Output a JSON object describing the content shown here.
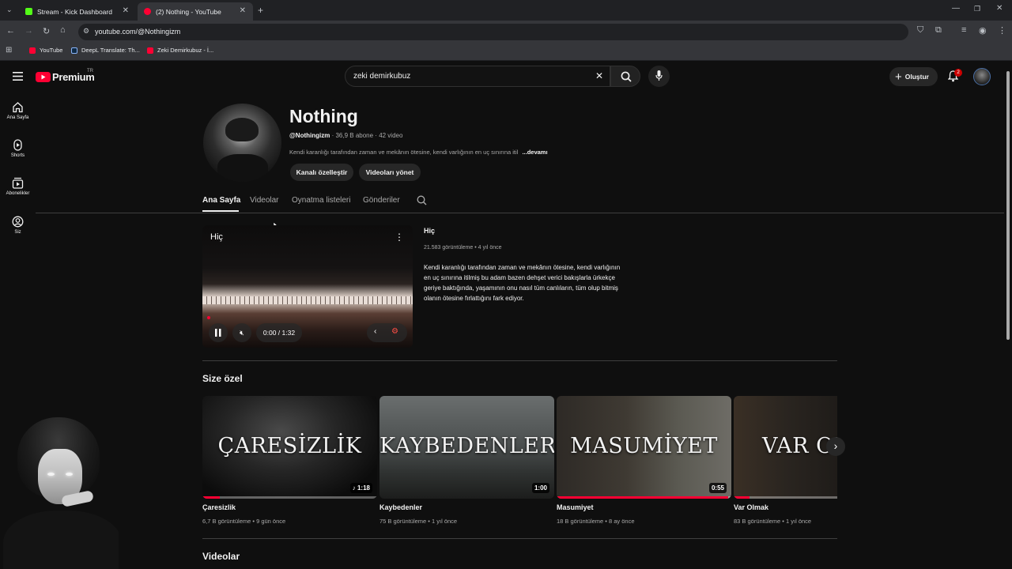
{
  "browser": {
    "tabs": [
      {
        "label": "Stream - Kick Dashboard",
        "favicon_color": "#53fc18"
      },
      {
        "label": "(2) Nothing - YouTube",
        "favicon_color": "#ff0033"
      }
    ],
    "url": "youtube.com/@Nothingizm",
    "bookmarks": [
      {
        "label": "YouTube",
        "color": "#ff0033"
      },
      {
        "label": "DeepL Translate: Th...",
        "color": "#0f2b46"
      },
      {
        "label": "Zeki Demirkubuz - İ...",
        "color": "#ff0033"
      }
    ]
  },
  "header": {
    "logo_text": "Premium",
    "logo_country": "TR",
    "search_value": "zeki demirkubuz",
    "create_label": "Oluştur",
    "notif_count": "2"
  },
  "sidebar": {
    "items": [
      {
        "label": "Ana Sayfa",
        "icon": "home-icon"
      },
      {
        "label": "Shorts",
        "icon": "shorts-icon"
      },
      {
        "label": "Abonelikler",
        "icon": "subscriptions-icon"
      },
      {
        "label": "Siz",
        "icon": "you-icon"
      }
    ]
  },
  "channel": {
    "name": "Nothing",
    "handle": "@Nothingizm",
    "stats": "· 36,9 B abone · 42 video",
    "description": "Kendi karanlığı tarafından zaman ve mekânın ötesine, kendi varlığının en uç sınırına itil",
    "more": "...devamı",
    "customize_label": "Kanalı özelleştir",
    "manage_label": "Videoları yönet",
    "tabs": [
      "Ana Sayfa",
      "Videolar",
      "Oynatma listeleri",
      "Gönderiler"
    ]
  },
  "featured": {
    "overlay_title": "Hiç",
    "title": "Hiç",
    "meta": "21.583 görüntüleme • 4 yıl önce",
    "description": "Kendi karanlığı tarafından zaman ve mekânın ötesine, kendi varlığının en uç sınırına itilmiş bu adam bazen dehşet verici bakışlarla ürkekçe geriye baktığında, yaşamının onu nasıl tüm canlıların, tüm olup bitmiş olanın ötesine fırlattığını fark ediyor.",
    "time": "0:00 / 1:32"
  },
  "for_you": {
    "heading": "Size özel",
    "cards": [
      {
        "thumb_text": "ÇARESİZLİK",
        "duration": "1:18",
        "title": "Çaresizlik",
        "meta": "6,7 B görüntüleme • 9 gün önce",
        "watched": 0.1,
        "music": true
      },
      {
        "thumb_text": "KAYBEDENLER",
        "duration": "1:00",
        "title": "Kaybedenler",
        "meta": "75 B görüntüleme • 1 yıl önce",
        "watched": 0,
        "music": false
      },
      {
        "thumb_text": "MASUMİYET",
        "duration": "0:55",
        "title": "Masumiyet",
        "meta": "18 B görüntüleme • 8 ay önce",
        "watched": 0.98,
        "music": false
      },
      {
        "thumb_text": "VAR OL",
        "duration": "",
        "title": "Var Olmak",
        "meta": "83 B görüntüleme • 1 yıl önce",
        "watched": 0.15,
        "music": false
      }
    ]
  },
  "videos_heading": "Videolar"
}
